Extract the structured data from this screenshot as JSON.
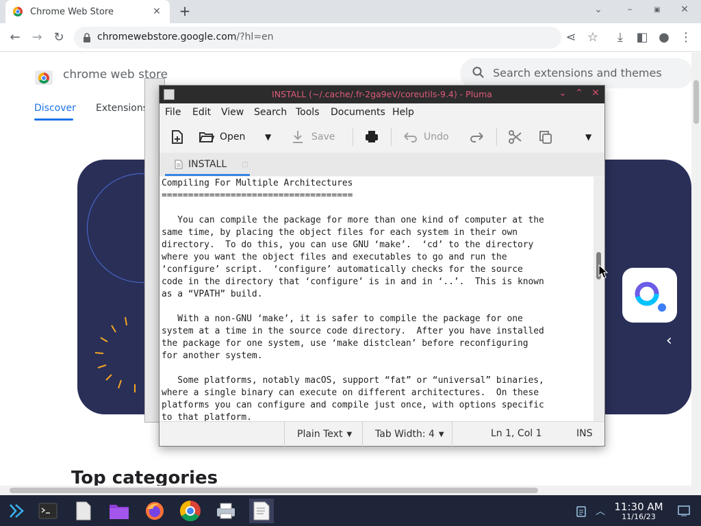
{
  "browser": {
    "tab_title": "Chrome Web Store",
    "new_tab_symbol": "+",
    "url_host": "chromewebstore.google.com",
    "url_path": "/?hl=en",
    "window_controls": [
      "chevron-down-icon",
      "minimize-icon",
      "maximize-icon",
      "close-icon"
    ],
    "toolbar_icons": [
      "back-icon",
      "forward-icon",
      "reload-icon",
      "share-icon",
      "star-icon",
      "download-icon",
      "side-panel-icon",
      "profile-icon",
      "menu-icon"
    ]
  },
  "store": {
    "name": "chrome web store",
    "search_placeholder": "Search extensions and themes",
    "nav": [
      "Discover",
      "Extensions"
    ],
    "top_categories": "Top categories"
  },
  "pluma": {
    "title": "INSTALL (~/.cache/.fr-2ga9eV/coreutils-9.4) - Pluma",
    "menu": [
      "File",
      "Edit",
      "View",
      "Search",
      "Tools",
      "Documents",
      "Help"
    ],
    "toolbar": {
      "open": "Open",
      "save": "Save",
      "undo": "Undo"
    },
    "tab_label": "INSTALL",
    "content": "Compiling For Multiple Architectures\n====================================\n\n   You can compile the package for more than one kind of computer at the\nsame time, by placing the object files for each system in their own\ndirectory.  To do this, you can use GNU ‘make’.  ‘cd’ to the directory\nwhere you want the object files and executables to go and run the\n‘configure’ script.  ‘configure’ automatically checks for the source\ncode in the directory that ‘configure’ is in and in ‘..’.  This is known\nas a “VPATH” build.\n\n   With a non-GNU ‘make’, it is safer to compile the package for one\nsystem at a time in the source code directory.  After you have installed\nthe package for one system, use ‘make distclean’ before reconfiguring\nfor another system.\n\n   Some platforms, notably macOS, support “fat” or “universal” binaries,\nwhere a single binary can execute on different architectures.  On these\nplatforms you can configure and compile just once, with options specific\nto that platform.",
    "status": {
      "language": "Plain Text",
      "tab_width": "Tab Width:  4",
      "position": "Ln 1, Col 1",
      "mode": "INS"
    }
  },
  "taskbar": {
    "time": "11:30 AM",
    "date": "11/16/23",
    "apps": [
      "launcher-icon",
      "terminal-icon",
      "text-file-icon",
      "folder-icon",
      "firefox-icon",
      "chrome-icon",
      "printer-icon",
      "pluma-icon"
    ]
  },
  "colors": {
    "accent": "#1a73e8",
    "hero_bg": "#2a2f58",
    "pluma_title": "#e05a7a",
    "taskbar_bg": "#1e2538"
  }
}
